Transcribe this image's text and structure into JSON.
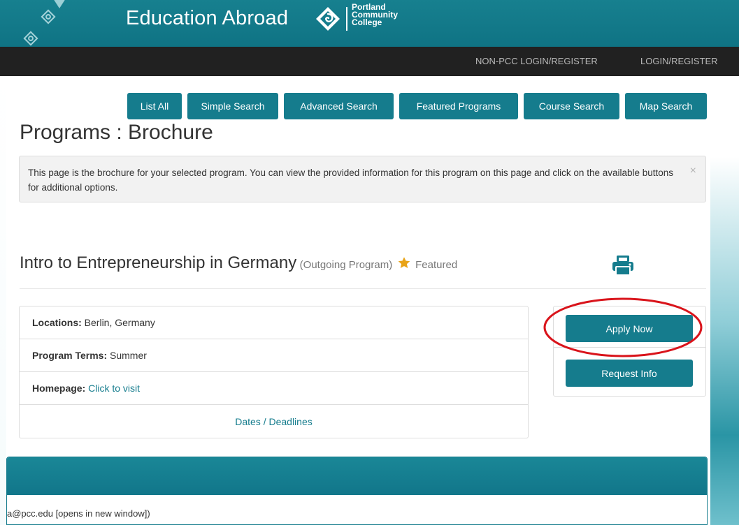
{
  "header": {
    "site_title": "Education Abroad",
    "logo_text": [
      "Portland",
      "Community",
      "College"
    ]
  },
  "topnav": {
    "non_pcc_login": "NON-PCC LOGIN/REGISTER",
    "login": "LOGIN/REGISTER"
  },
  "tabs": [
    {
      "label": "List All"
    },
    {
      "label": "Simple Search"
    },
    {
      "label": "Advanced Search"
    },
    {
      "label": "Featured Programs"
    },
    {
      "label": "Course Search"
    },
    {
      "label": "Map Search"
    }
  ],
  "page": {
    "title": "Programs : Brochure",
    "info_message": "This page is the brochure for your selected program. You can view the provided information for this program on this page and click on the available buttons for additional options.",
    "info_close": "×"
  },
  "program": {
    "name": "Intro to Entrepreneurship in Germany",
    "type": "(Outgoing Program)",
    "featured": "Featured",
    "details": {
      "locations_label": "Locations:",
      "locations_value": "Berlin, Germany",
      "terms_label": "Program Terms:",
      "terms_value": "Summer",
      "homepage_label": "Homepage:",
      "homepage_link": "Click to visit",
      "dates_link": "Dates / Deadlines"
    },
    "actions": {
      "apply": "Apply Now",
      "request_info": "Request Info"
    }
  },
  "lower": {
    "contact_text": "a@pcc.edu [opens in new window])"
  },
  "colors": {
    "teal": "#157c8d",
    "dark_nav": "#212121",
    "highlight_circle": "#d9141b",
    "star": "#e8a317"
  },
  "icons": {
    "print": "printer-icon",
    "star": "star-icon",
    "logo": "pcc-logo-icon"
  }
}
